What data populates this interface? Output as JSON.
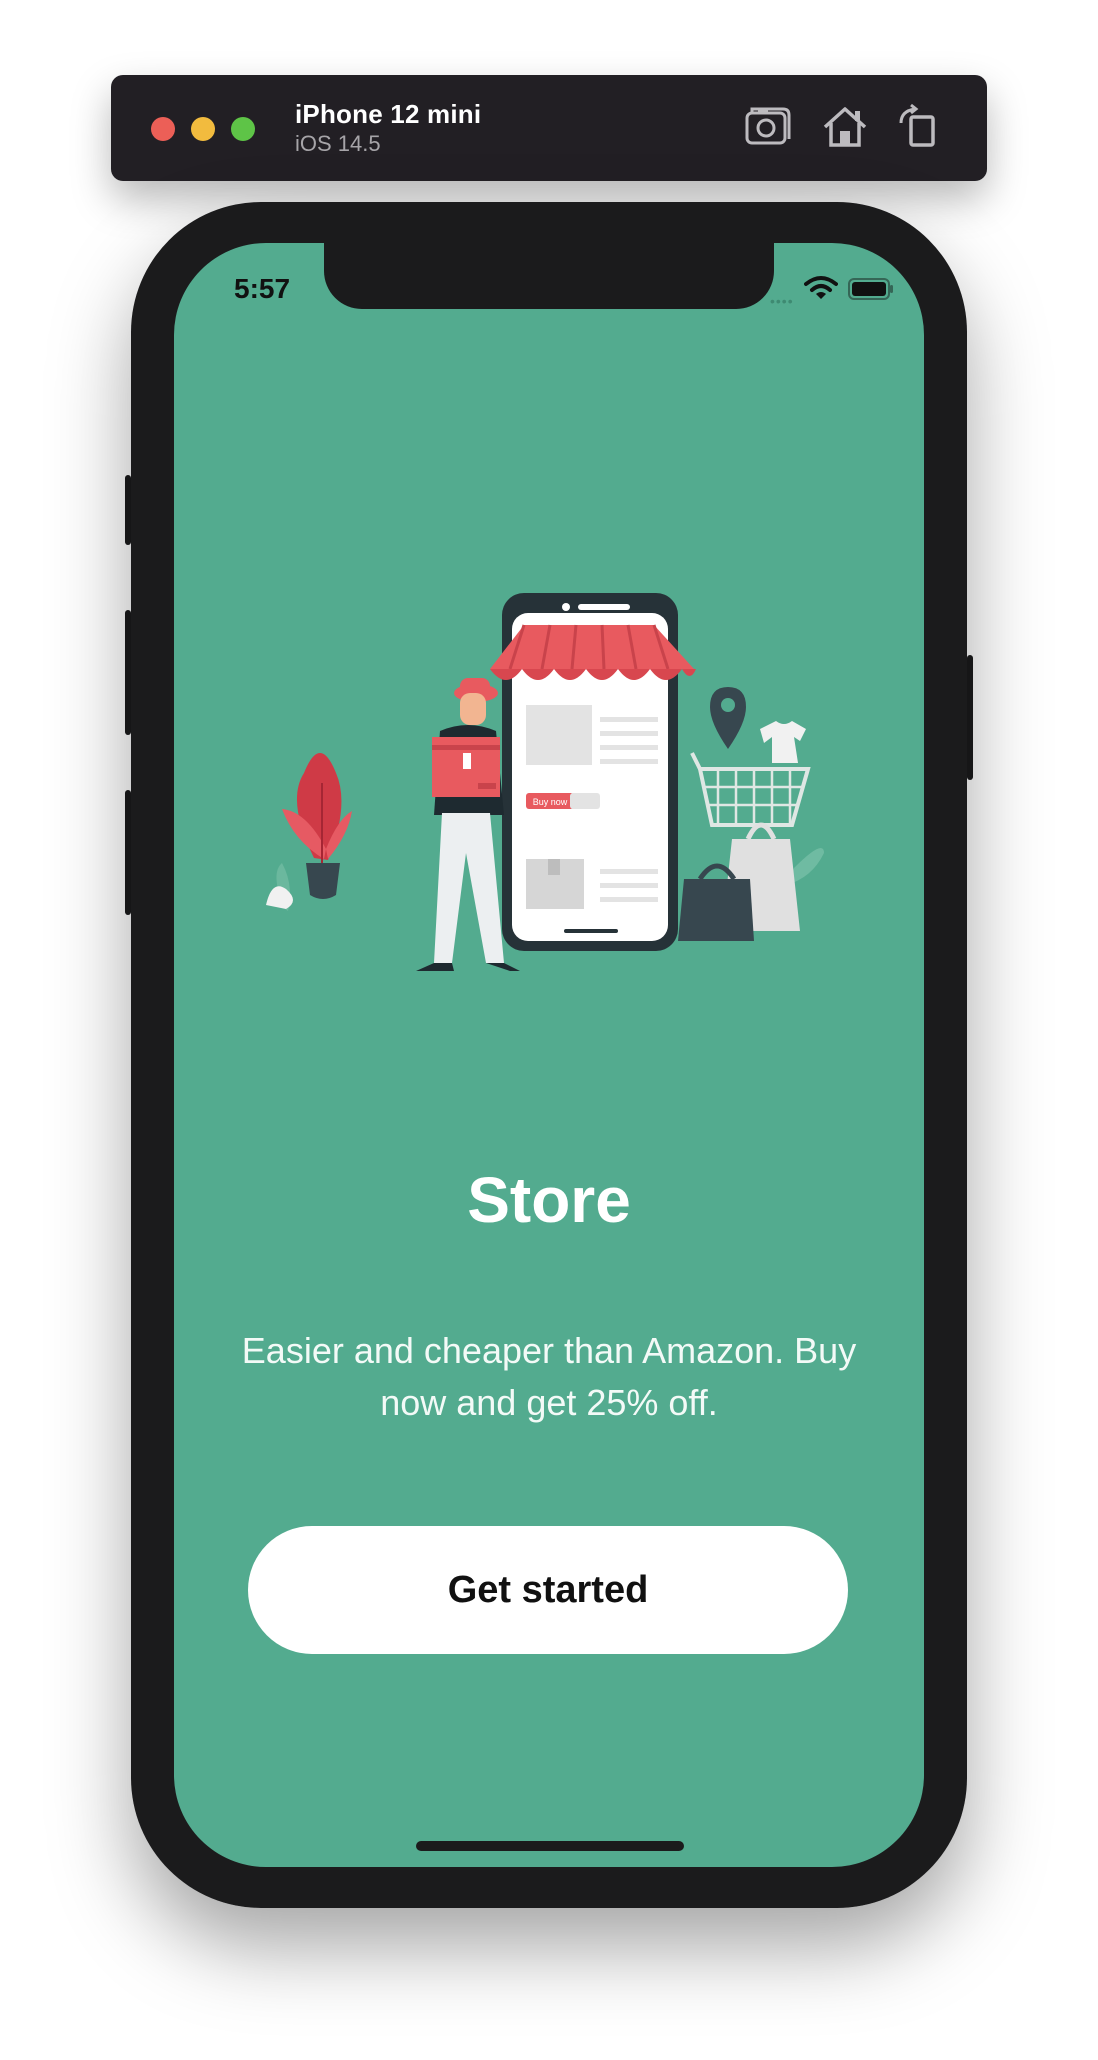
{
  "simulator": {
    "device_name": "iPhone 12 mini",
    "os_version": "iOS 14.5",
    "toolbar_icons": [
      "screenshot-icon",
      "home-icon",
      "rotate-icon"
    ]
  },
  "status_bar": {
    "time": "5:57",
    "icons": [
      "wifi-icon",
      "battery-icon"
    ]
  },
  "illustration": {
    "subject": "shop-illustration",
    "button_text": "Buy now"
  },
  "onboarding": {
    "title": "Store",
    "subtitle": "Easier and cheaper than Amazon. Buy now and get 25% off.",
    "cta_label": "Get started"
  },
  "colors": {
    "screen_background": "#53ab8f",
    "awning_red": "#e85a5f",
    "dark_slate": "#37474f",
    "button_background": "#ffffff"
  }
}
